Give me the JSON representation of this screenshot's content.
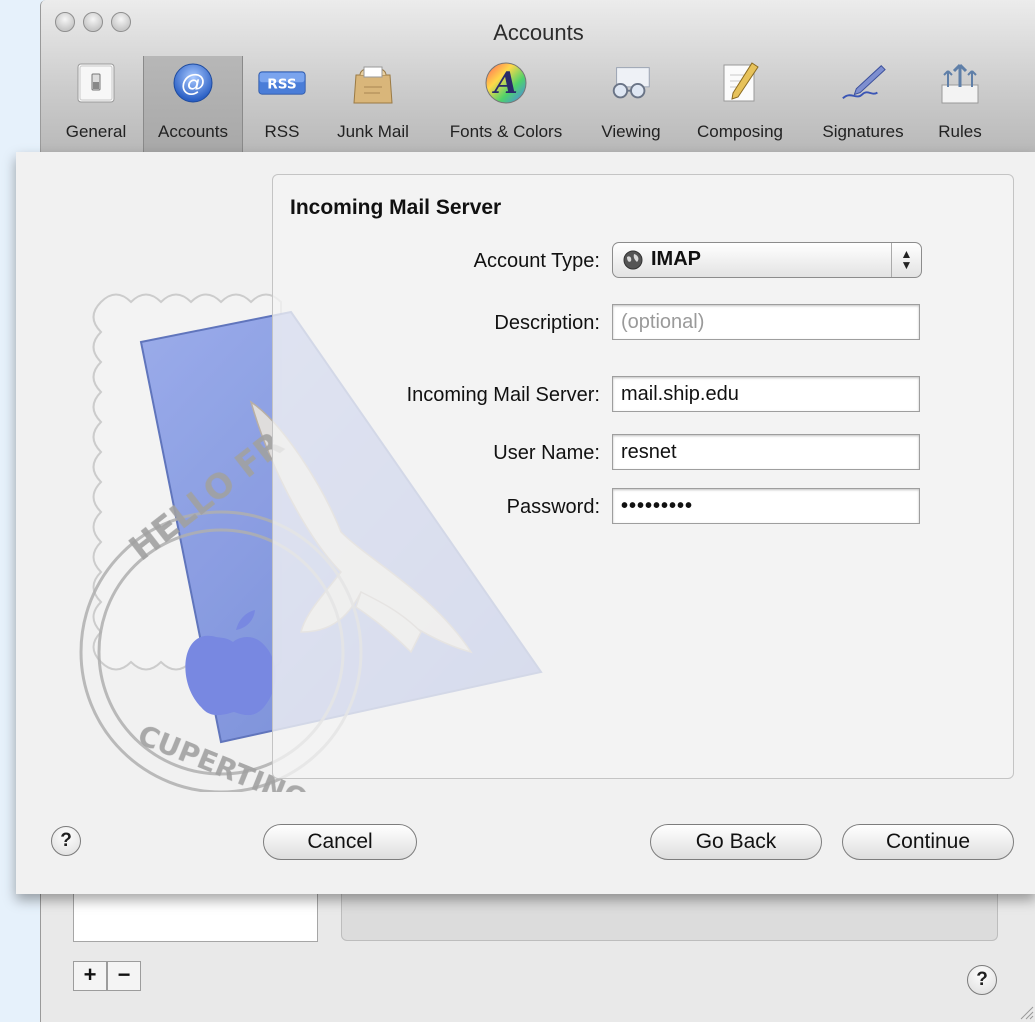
{
  "window": {
    "title": "Accounts"
  },
  "toolbar": {
    "items": [
      {
        "label": "General",
        "icon": "general-switch-icon"
      },
      {
        "label": "Accounts",
        "icon": "at-sign-icon",
        "selected": true
      },
      {
        "label": "RSS",
        "icon": "rss-icon"
      },
      {
        "label": "Junk Mail",
        "icon": "junk-mail-bag-icon"
      },
      {
        "label": "Fonts & Colors",
        "icon": "fonts-colors-icon"
      },
      {
        "label": "Viewing",
        "icon": "glasses-icon"
      },
      {
        "label": "Composing",
        "icon": "composing-pencil-icon"
      },
      {
        "label": "Signatures",
        "icon": "signature-pen-icon"
      },
      {
        "label": "Rules",
        "icon": "rules-arrows-icon"
      }
    ],
    "rss_text": "RSS",
    "fonts_glyph": "A",
    "at_glyph": "@"
  },
  "sheet": {
    "section_title": "Incoming Mail Server",
    "account_type": {
      "label": "Account Type:",
      "value": "IMAP"
    },
    "description": {
      "label": "Description:",
      "value": "",
      "placeholder": "(optional)"
    },
    "server": {
      "label": "Incoming Mail Server:",
      "value": "mail.ship.edu"
    },
    "username": {
      "label": "User Name:",
      "value": "resnet"
    },
    "password": {
      "label": "Password:",
      "value": "•••••••••"
    },
    "stamp_text": {
      "top": "HELLO FR",
      "bottom": "CUPERTINO CA"
    },
    "buttons": {
      "help": "?",
      "cancel": "Cancel",
      "go_back": "Go Back",
      "continue": "Continue"
    }
  },
  "background": {
    "add_label": "+",
    "remove_label": "−",
    "help": "?"
  },
  "colors": {
    "window_bg": "#e9e9e9",
    "desktop_bg": "#e6f1fb",
    "stamp_blue": "#6f86d6"
  }
}
